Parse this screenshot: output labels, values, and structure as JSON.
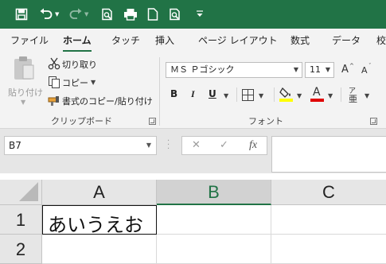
{
  "qat": {
    "icons": [
      "save-icon",
      "undo-icon",
      "redo-icon",
      "print-preview-icon",
      "quick-print-icon",
      "new-document-icon",
      "find-icon",
      "customize-icon"
    ]
  },
  "tabs": [
    {
      "label": "ファイル"
    },
    {
      "label": "ホーム"
    },
    {
      "label": "タッチ"
    },
    {
      "label": "挿入"
    },
    {
      "label": "ページ レイアウト"
    },
    {
      "label": "数式"
    },
    {
      "label": "データ"
    },
    {
      "label": "校"
    }
  ],
  "clipboard": {
    "paste": "貼り付け",
    "cut": "切り取り",
    "copy": "コピー",
    "format_painter": "書式のコピー/貼り付け",
    "group_label": "クリップボード"
  },
  "font": {
    "name": "ＭＳ Ｐゴシック",
    "size": "11",
    "bold": "B",
    "italic": "I",
    "underline": "U",
    "group_label": "フォント",
    "highlight_color": "#ffff00",
    "font_color": "#e00000"
  },
  "formula_bar": {
    "name_box": "B7",
    "cancel": "✕",
    "enter": "✓",
    "fx": "fx",
    "value": ""
  },
  "sheet": {
    "columns": [
      "A",
      "B",
      "C"
    ],
    "rows": [
      "1",
      "2"
    ],
    "cells": {
      "A1": "あいうえお"
    }
  },
  "colors": {
    "accent": "#217346"
  }
}
